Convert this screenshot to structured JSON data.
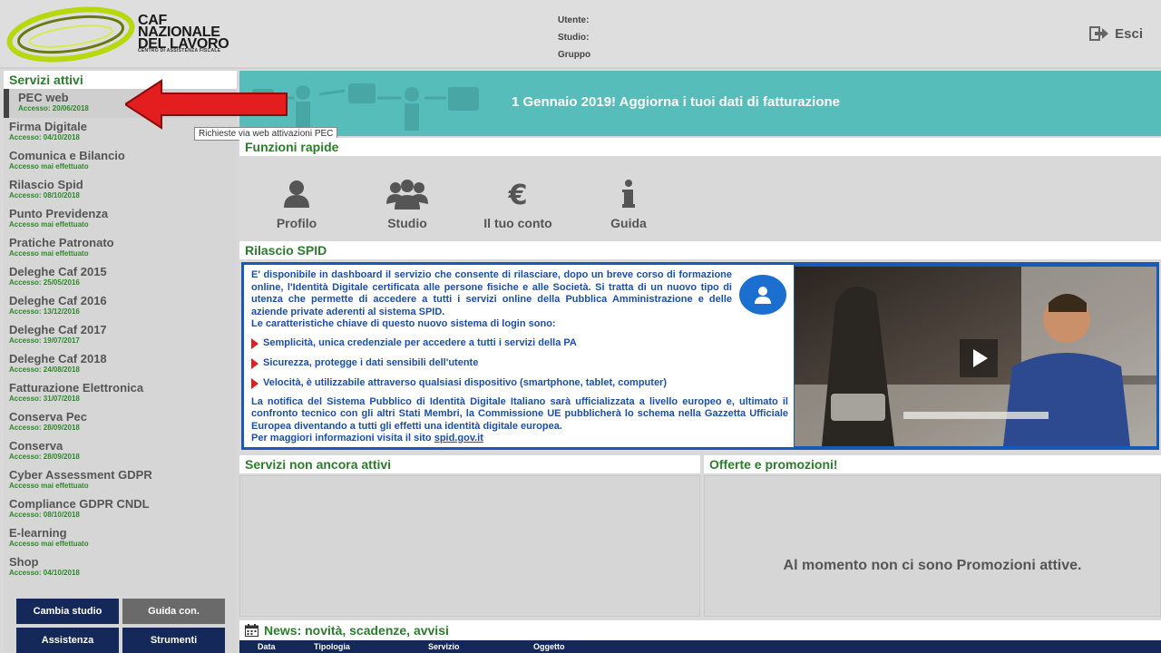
{
  "header": {
    "logo_line1": "CAF",
    "logo_line2": "NAZIONALE",
    "logo_line3": "DEL LAVORO",
    "logo_sub": "CENTRO DI ASSISTENZA FISCALE",
    "user_label": "Utente:",
    "studio_label": "Studio:",
    "group_label": "Gruppo",
    "exit_label": "Esci",
    "exit_icon": "sign-out-icon"
  },
  "sidebar": {
    "title": "Servizi attivi",
    "items": [
      {
        "name": "PEC web",
        "access": "Accesso: 20/06/2018"
      },
      {
        "name": "Firma Digitale",
        "access": "Accesso: 04/10/2018"
      },
      {
        "name": "Comunica e Bilancio",
        "access": "Accesso mai effettuato"
      },
      {
        "name": "Rilascio Spid",
        "access": "Accesso: 08/10/2018"
      },
      {
        "name": "Punto Previdenza",
        "access": "Accesso mai effettuato"
      },
      {
        "name": "Pratiche Patronato",
        "access": "Accesso mai effettuato"
      },
      {
        "name": "Deleghe Caf 2015",
        "access": "Accesso: 25/05/2016"
      },
      {
        "name": "Deleghe Caf 2016",
        "access": "Accesso: 13/12/2016"
      },
      {
        "name": "Deleghe Caf 2017",
        "access": "Accesso: 19/07/2017"
      },
      {
        "name": "Deleghe Caf 2018",
        "access": "Accesso: 24/08/2018"
      },
      {
        "name": "Fatturazione Elettronica",
        "access": "Accesso: 31/07/2018"
      },
      {
        "name": "Conserva Pec",
        "access": "Accesso: 28/09/2018"
      },
      {
        "name": "Conserva",
        "access": "Accesso: 28/09/2018"
      },
      {
        "name": "Cyber Assessment GDPR",
        "access": "Accesso mai effettuato"
      },
      {
        "name": "Compliance GDPR CNDL",
        "access": "Accesso: 08/10/2018"
      },
      {
        "name": "E-learning",
        "access": "Accesso mai effettuato"
      },
      {
        "name": "Shop",
        "access": "Accesso: 04/10/2018"
      }
    ],
    "buttons": {
      "cambia_studio": "Cambia studio",
      "guida_con": "Guida con.",
      "assistenza": "Assistenza",
      "strumenti": "Strumenti"
    }
  },
  "tooltip": "Richieste via web attivazioni PEC",
  "banner": {
    "text": "1 Gennaio 2019! Aggiorna i tuoi dati di fatturazione"
  },
  "quick_functions": {
    "title": "Funzioni rapide",
    "items": [
      {
        "label": "Profilo",
        "icon": "user-icon"
      },
      {
        "label": "Studio",
        "icon": "users-icon"
      },
      {
        "label": "Il tuo conto",
        "icon": "euro-icon"
      },
      {
        "label": "Guida",
        "icon": "info-icon"
      }
    ]
  },
  "spid": {
    "title": "Rilascio SPID",
    "intro": "E' disponibile in dashboard il servizio che consente di rilasciare, dopo un breve corso di formazione online, l'Identità Digitale certificata alle persone fisiche e alle Società. Si tratta di un nuovo tipo di utenza che permette di accedere a tutti i servizi online della Pubblica Amministrazione e delle aziende private aderenti al sistema SPID.",
    "features_heading": "Le caratteristiche chiave di questo nuovo sistema di login sono:",
    "bullets": [
      "Semplicità, unica credenziale per accedere a tutti i servizi della PA",
      "Sicurezza, protegge i dati sensibili dell'utente",
      "Velocità, è utilizzabile attraverso qualsiasi dispositivo (smartphone, tablet, computer)"
    ],
    "notice": "La notifica del Sistema Pubblico di Identità Digitale Italiano sarà ufficializzata a livello europeo e, ultimato il confronto tecnico con gli altri Stati Membri, la Commissione UE pubblicherà lo schema nella Gazzetta Ufficiale Europea diventando a tutti gli effetti una identità digitale europea.",
    "more_info": "Per maggiori informazioni visita il sito",
    "link": "spid.gov.it"
  },
  "panels": {
    "inactive_title": "Servizi non ancora attivi",
    "offers_title": "Offerte e promozioni!",
    "offers_empty": "Al momento non ci sono Promozioni attive."
  },
  "news": {
    "title": "News: novità, scadenze, avvisi",
    "columns": [
      "Data",
      "Tipologia",
      "Servizio",
      "Oggetto"
    ]
  },
  "colors": {
    "accent_green": "#2b7d2b",
    "banner_teal": "#56bdbb",
    "spid_blue": "#1659b8",
    "navy": "#14285a"
  }
}
